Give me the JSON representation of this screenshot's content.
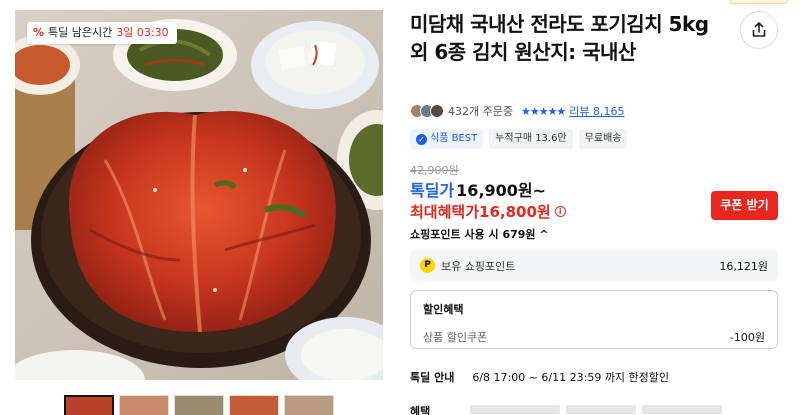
{
  "image": {
    "timer_label": "특딜 남은시간",
    "timer_value": "3일 03:30"
  },
  "thumbnails": [
    {
      "color": "#b8432a"
    },
    {
      "color": "#c98a6b"
    },
    {
      "color": "#9a8a70"
    },
    {
      "color": "#c45c3a"
    },
    {
      "color": "#b89a80"
    }
  ],
  "product": {
    "title": "미담채 국내산 전라도 포기김치 5kg 외 6종 김치 원산지: 국내산",
    "order_count": "432개 주문중",
    "stars": "★★★★★",
    "review_link": "리뷰 8,165",
    "badges": [
      "식품 BEST",
      "누적구매 13.6만",
      "무료배송"
    ]
  },
  "price": {
    "original": "42,900원",
    "deal_label": "톡딜가",
    "deal_price": "16,900원~",
    "max_label": "최대혜택가",
    "max_price": "16,800원",
    "coupon_button": "쿠폰 받기",
    "point_use": "쇼핑포인트 사용 시 679원 ^"
  },
  "points": {
    "label": "보유 쇼핑포인트",
    "value": "16,121원"
  },
  "discount": {
    "title": "할인혜택",
    "row_label": "상품 할인쿠폰",
    "row_value": "-100원"
  },
  "deal_info": {
    "label": "톡딜 안내",
    "value": "6/8 17:00 ~ 6/11 23:59 까지 한정할인"
  },
  "cut_off": {
    "label": "혜택"
  },
  "colors": {
    "accent_blue": "#1d5fe8",
    "accent_red": "#e8281e",
    "point_yellow": "#ffd400"
  }
}
